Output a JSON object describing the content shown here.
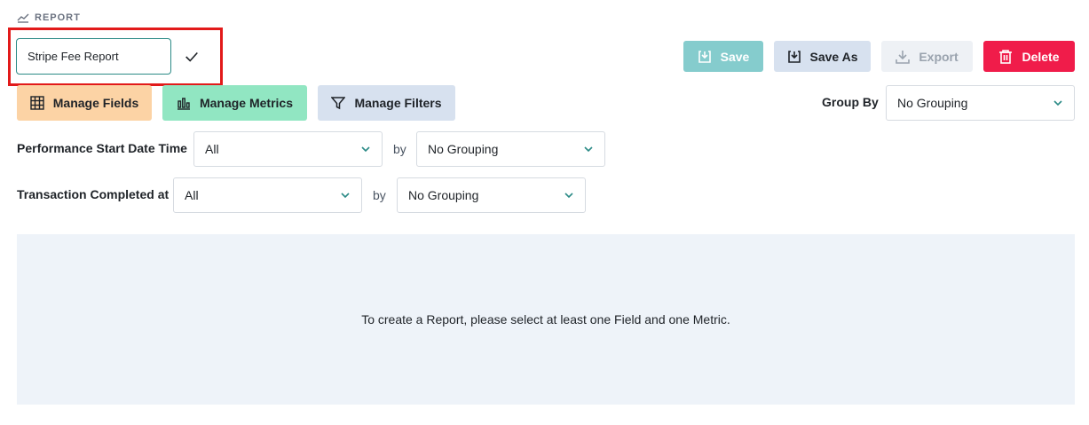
{
  "header": {
    "section_label": "REPORT",
    "icon": "trend-line-icon"
  },
  "report_name": {
    "value": "Stripe Fee Report",
    "confirm_icon": "checkmark-icon"
  },
  "toolbar": {
    "save_label": "Save",
    "save_as_label": "Save As",
    "export_label": "Export",
    "delete_label": "Delete"
  },
  "manage": {
    "fields_label": "Manage Fields",
    "metrics_label": "Manage Metrics",
    "filters_label": "Manage Filters"
  },
  "group_by": {
    "label": "Group By",
    "value": "No Grouping"
  },
  "date_filters": [
    {
      "label": "Performance Start Date Time",
      "range": "All",
      "by": "by",
      "grouping": "No Grouping"
    },
    {
      "label": "Transaction Completed at",
      "range": "All",
      "by": "by",
      "grouping": "No Grouping"
    }
  ],
  "empty_state": {
    "message": "To create a Report, please select at least one Field and one Metric."
  },
  "colors": {
    "save": "#85cccd",
    "save_as": "#d7e1ef",
    "export": "#eef1f5",
    "delete": "#f01c4a",
    "fields": "#fcd3a5",
    "metrics": "#91e6c2",
    "filters": "#d7e1ef",
    "highlight": "#e21a1a",
    "chevron": "#2b8a86"
  }
}
